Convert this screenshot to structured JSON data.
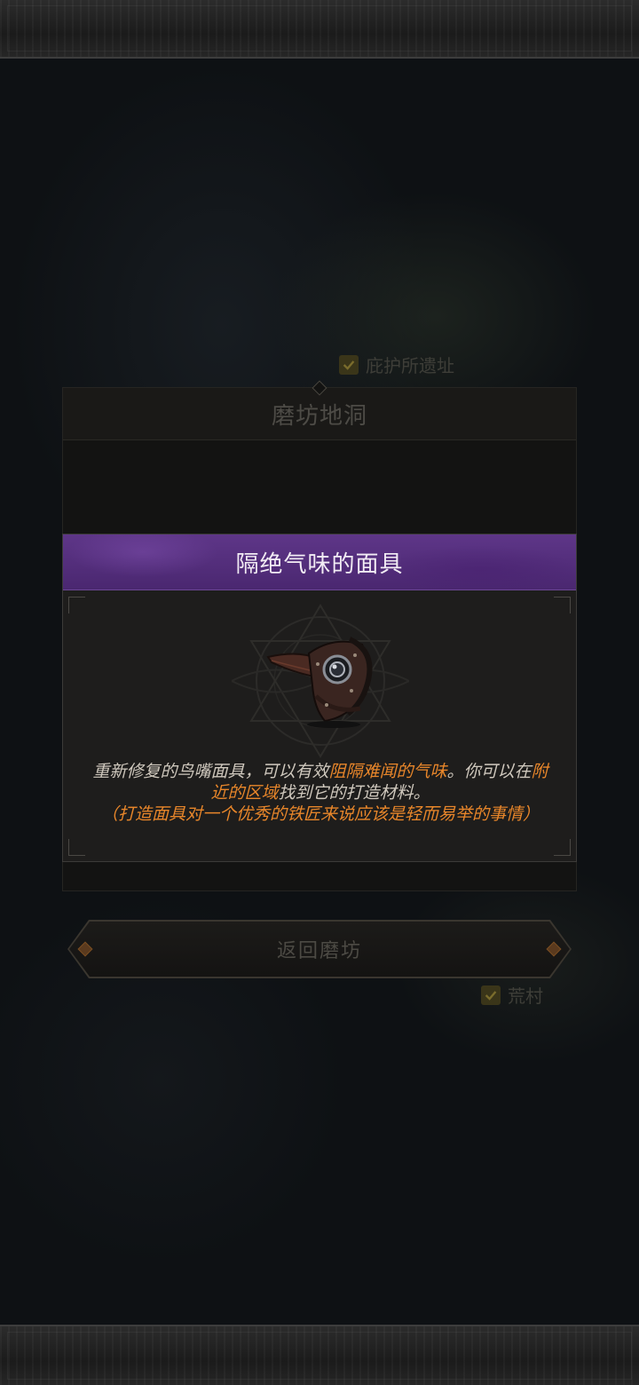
{
  "map": {
    "labels": [
      {
        "text": "庇护所遗址",
        "checked": true
      },
      {
        "text": "荒村",
        "checked": true
      }
    ]
  },
  "location_panel": {
    "title": "磨坊地洞",
    "return_button": "返回磨坊"
  },
  "item_dialog": {
    "title": "隔绝气味的面具",
    "icon": "plague-mask-icon",
    "desc_part1": "重新修复的鸟嘴面具，可以有效",
    "desc_highlight1": "阻隔难闻的气味",
    "desc_part2": "。你可以在",
    "desc_highlight2": "附近的区域",
    "desc_part3": "找到它的打造材料。",
    "desc_note": "（打造面具对一个优秀的铁匠来说应该是轻而易举的事情）"
  },
  "colors": {
    "header_purple": "#4a2770",
    "highlight_orange": "#e8862a",
    "desc_text": "#cfc8bd"
  }
}
